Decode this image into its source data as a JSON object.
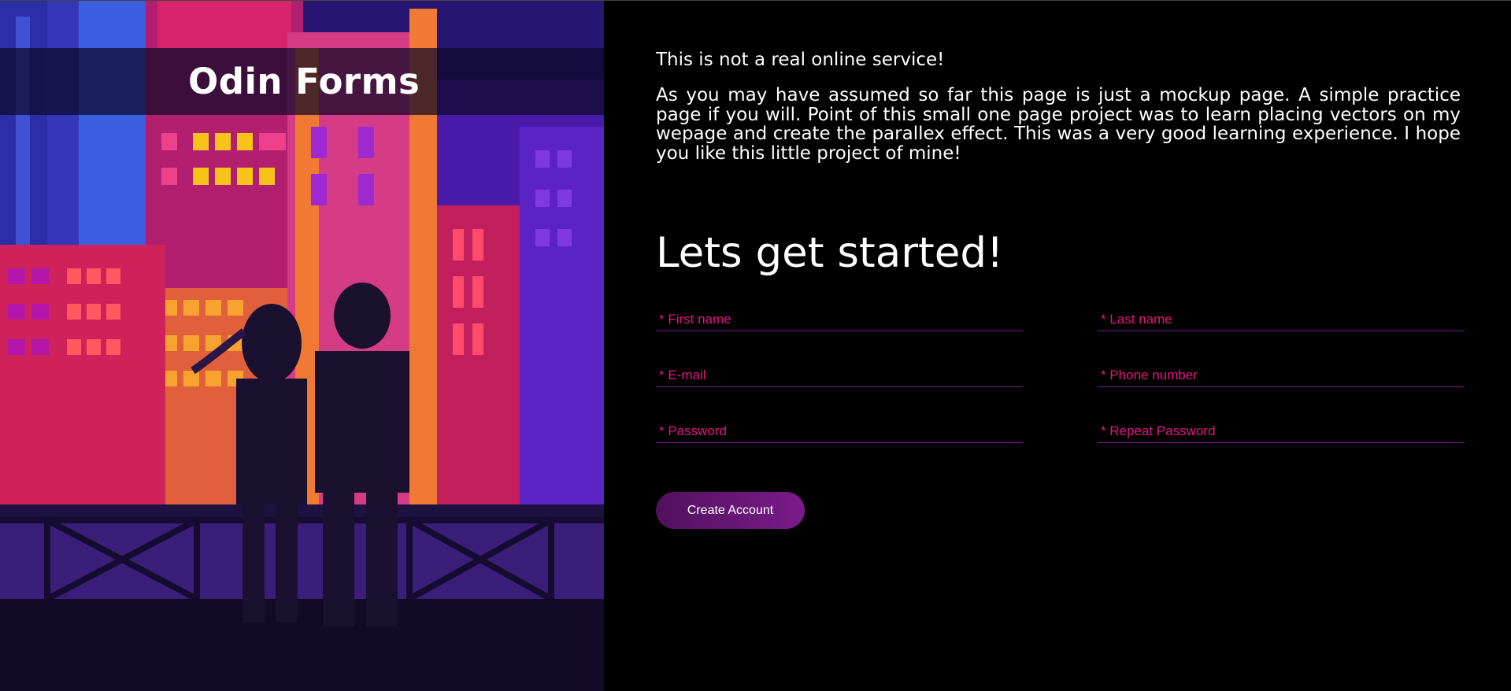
{
  "brand": {
    "logo_text": "Odin Forms"
  },
  "intro": {
    "title": "This is not a real online service!",
    "body": "As you may have assumed so far this page is just a mockup page. A simple practice page if you will. Point of this small one page project was to learn placing vectors on my wepage and create the parallex effect. This was a very good learning experience. I hope you like this little project of mine!"
  },
  "form": {
    "heading": "Lets get started!",
    "fields": {
      "first_name": {
        "placeholder": "* First name",
        "value": ""
      },
      "last_name": {
        "placeholder": "* Last name",
        "value": ""
      },
      "email": {
        "placeholder": "* E-mail",
        "value": ""
      },
      "phone": {
        "placeholder": "* Phone number",
        "value": ""
      },
      "password": {
        "placeholder": "* Password",
        "value": ""
      },
      "repeat_password": {
        "placeholder": "* Repeat Password",
        "value": ""
      }
    },
    "submit_label": "Create Account"
  },
  "colors": {
    "background": "#000000",
    "placeholder_accent": "#e0187f",
    "underline": "#7b1f95",
    "button_start": "#52105e",
    "button_end": "#7a1c8a"
  },
  "illustration": {
    "subject": "city-night-couple-illustration"
  }
}
